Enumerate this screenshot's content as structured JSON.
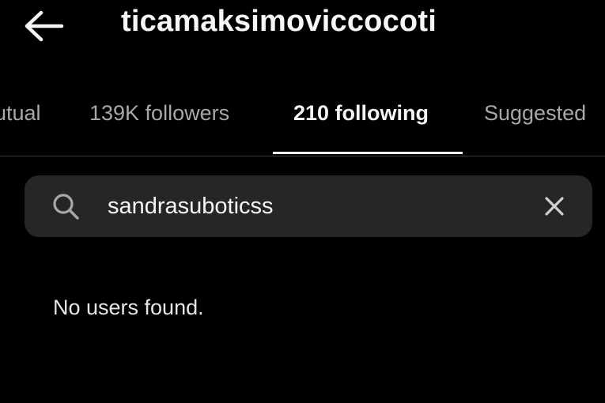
{
  "header": {
    "back_icon": "arrow-left-icon",
    "username": "ticamaksimoviccocoti"
  },
  "tabs": [
    {
      "label": "utual",
      "active": false
    },
    {
      "label": "139K followers",
      "active": false
    },
    {
      "label": "210 following",
      "active": true
    },
    {
      "label": "Suggested",
      "active": false
    }
  ],
  "search": {
    "icon": "search-icon",
    "value": "sandrasuboticss",
    "clear_icon": "close-icon"
  },
  "results": {
    "empty_message": "No users found."
  },
  "colors": {
    "background": "#000000",
    "search_background": "#262626",
    "text_primary": "#f5f5f5",
    "text_secondary": "#a8a8a8"
  }
}
